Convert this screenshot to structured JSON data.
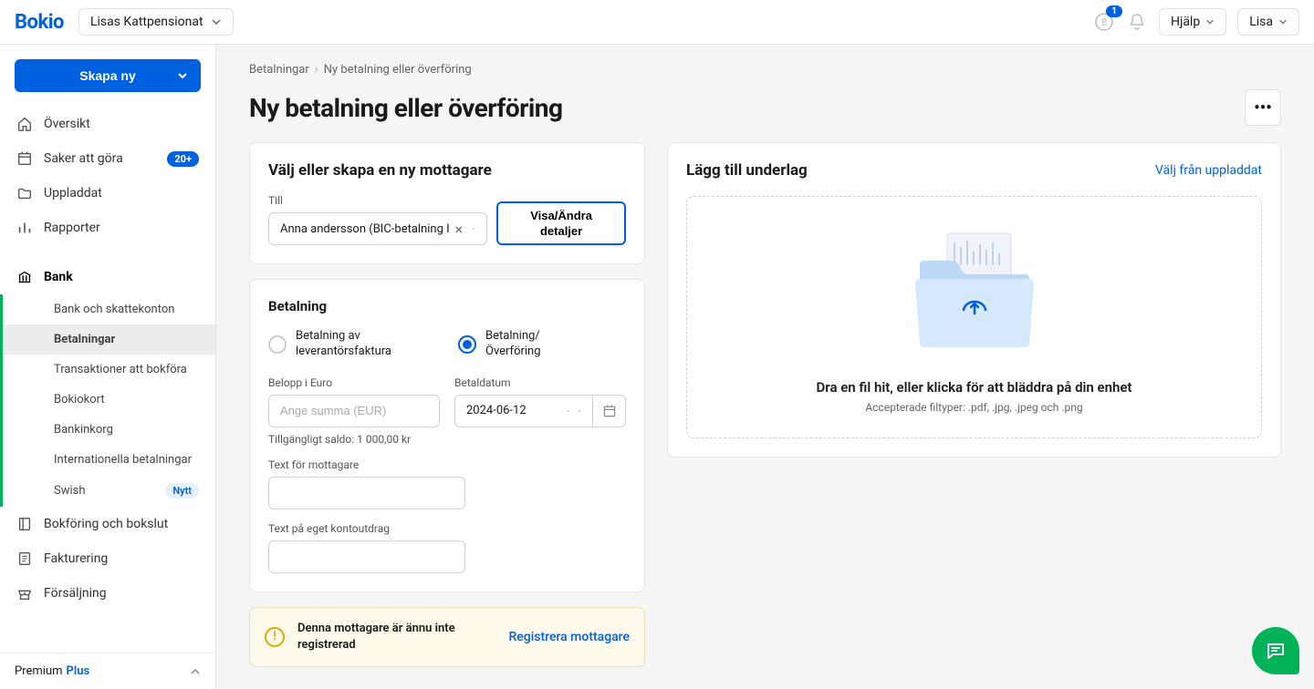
{
  "header": {
    "logo": "Bokio",
    "company": "Lisas Kattpensionat",
    "notification_count": "1",
    "help_label": "Hjälp",
    "user_label": "Lisa"
  },
  "sidebar": {
    "create_label": "Skapa ny",
    "items": {
      "overview": "Översikt",
      "todo": "Saker att göra",
      "todo_count": "20+",
      "uploaded": "Uppladdat",
      "reports": "Rapporter",
      "bank": "Bank",
      "accounting": "Bokföring och bokslut",
      "invoicing": "Fakturering",
      "sales": "Försäljning"
    },
    "bank_sub": {
      "accounts": "Bank och skattekonton",
      "payments": "Betalningar",
      "transactions": "Transaktioner att bokföra",
      "bokiokort": "Bokiokort",
      "inbox": "Bankinkorg",
      "international": "Internationella betalningar",
      "swish": "Swish",
      "swish_new": "Nytt"
    },
    "footer_plan": "Premium",
    "footer_plan_plus": "Plus"
  },
  "breadcrumb": {
    "parent": "Betalningar",
    "current": "Ny betalning eller överföring"
  },
  "page": {
    "title": "Ny betalning eller överföring"
  },
  "recipient_card": {
    "title": "Välj eller skapa en ny mottagare",
    "to_label": "Till",
    "selected": "Anna andersson (BIC-betalning I",
    "details_btn": "Visa/Ändra detaljer"
  },
  "payment_card": {
    "title": "Betalning",
    "opt_invoice": "Betalning av leverantörsfaktura",
    "opt_transfer": "Betalning/\nÖverföring",
    "amount_label": "Belopp i Euro",
    "amount_placeholder": "Ange summa (EUR)",
    "balance_text": "Tillgängligt saldo: 1 000,00 kr",
    "date_label": "Betaldatum",
    "date_value": "2024-06-12",
    "recipient_text_label": "Text för mottagare",
    "own_text_label": "Text på eget kontoutdrag"
  },
  "warning": {
    "text": "Denna mottagare är ännu inte registrerad",
    "link": "Registrera mottagare"
  },
  "upload": {
    "title": "Lägg till underlag",
    "choose_link": "Välj från uppladdat",
    "dz_text": "Dra en fil hit, eller klicka för att bläddra på din enhet",
    "dz_sub": "Accepterade filtyper: .pdf, .jpg, .jpeg och .png"
  }
}
